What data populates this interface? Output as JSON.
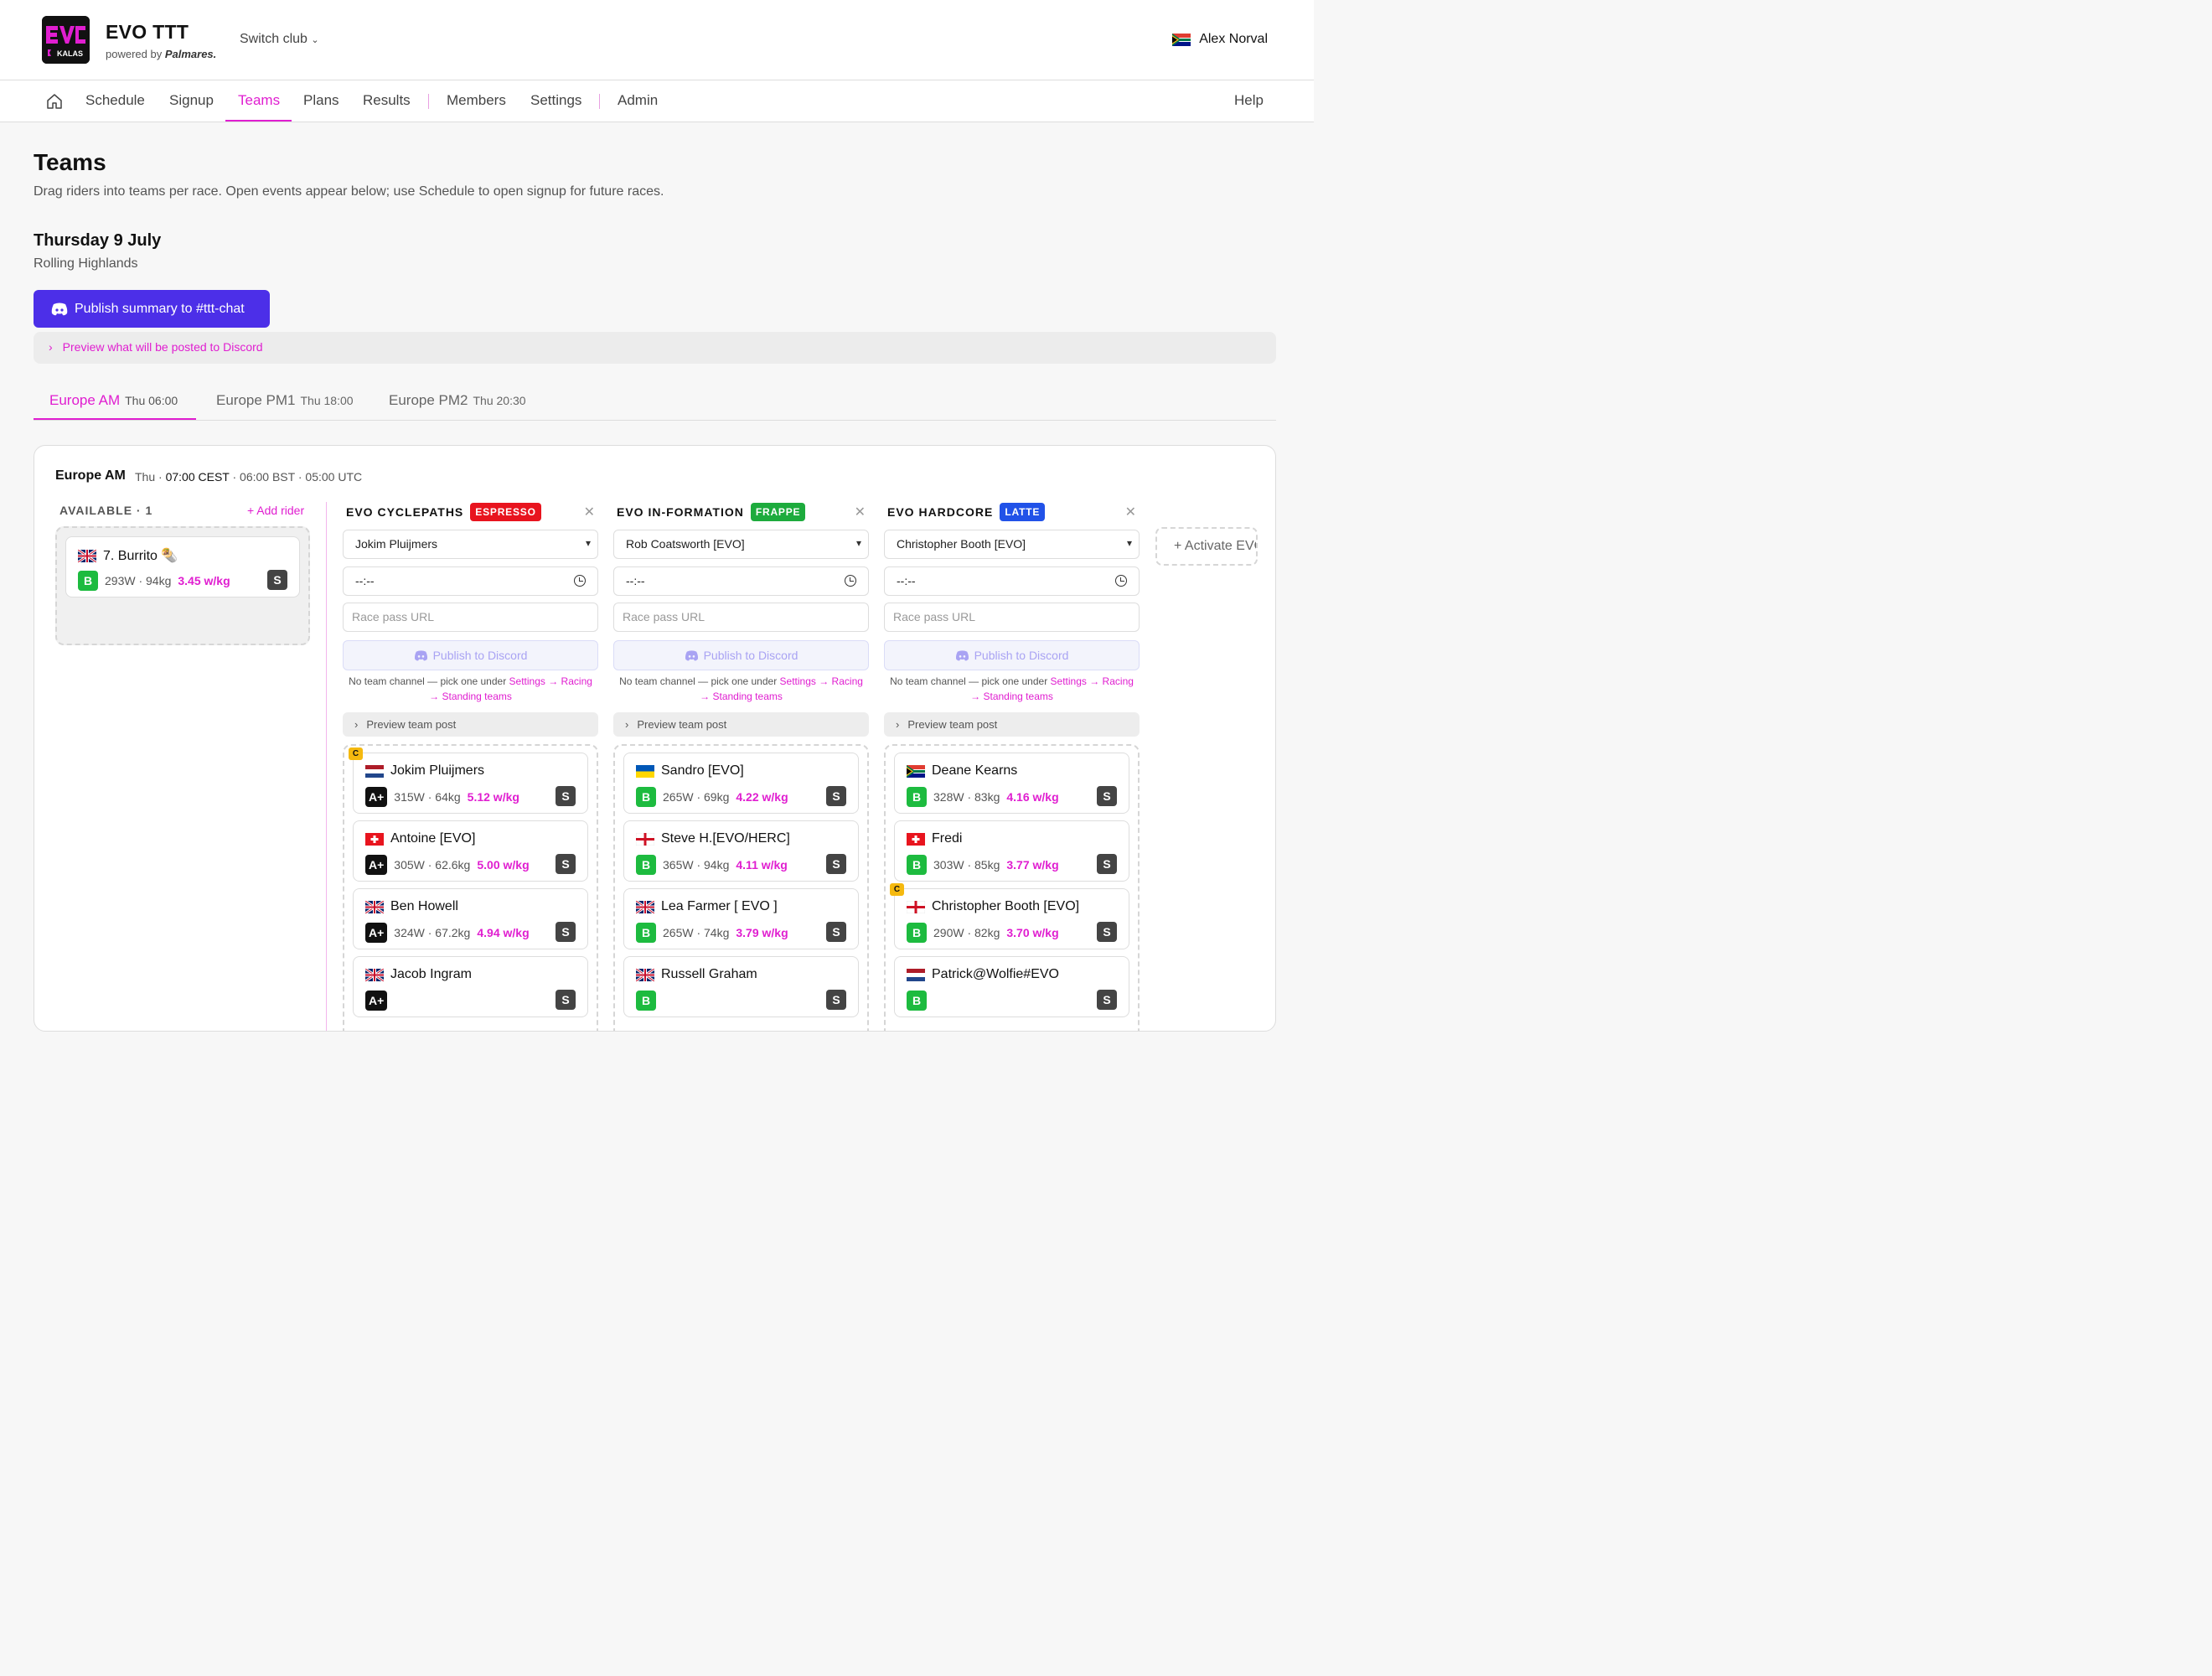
{
  "header": {
    "app_title": "EVO TTT",
    "powered_by_prefix": "powered by",
    "powered_by_brand": "Palmares.",
    "switch_club": "Switch club",
    "user_name": "Alex Norval",
    "logo_text": "KALAS"
  },
  "nav": {
    "items": [
      "Schedule",
      "Signup",
      "Teams",
      "Plans",
      "Results",
      "Members",
      "Settings",
      "Admin"
    ],
    "active": "Teams",
    "help": "Help"
  },
  "page": {
    "title": "Teams",
    "subtitle": "Drag riders into teams per race. Open events appear below; use Schedule to open signup for future races.",
    "date": "Thursday 9 July",
    "course": "Rolling Highlands",
    "publish_button": "Publish summary to #ttt-chat",
    "preview_toggle": "Preview what will be posted to Discord"
  },
  "tabs": [
    {
      "label": "Europe AM",
      "time": "Thu 06:00",
      "active": true
    },
    {
      "label": "Europe PM1",
      "time": "Thu 18:00",
      "active": false
    },
    {
      "label": "Europe PM2",
      "time": "Thu 20:30",
      "active": false
    }
  ],
  "event": {
    "title": "Europe AM",
    "day": "Thu",
    "time_cest": "07:00 CEST",
    "time_bst": "06:00 BST",
    "time_utc": "05:00 UTC"
  },
  "available": {
    "heading": "AVAILABLE · 1",
    "add_rider": "+ Add rider",
    "riders": [
      {
        "flag": "uk",
        "name": "7. Burrito 🌯",
        "cat": "B",
        "stats": "293W · 94kg",
        "wkg": "3.45 w/kg",
        "badge": "S"
      }
    ]
  },
  "team_common": {
    "time_placeholder": "--:--",
    "race_pass_placeholder": "Race pass URL",
    "publish_label": "Publish to Discord",
    "no_channel_prefix": "No team channel — pick one under",
    "no_channel_link": "Settings → Racing → Standing teams",
    "preview_post": "Preview team post"
  },
  "teams": [
    {
      "name": "EVO CYCLEPATHS",
      "badge": "ESPRESSO",
      "badge_color": "#e8141e",
      "captain_select": "Jokim Pluijmers",
      "riders": [
        {
          "flag": "nl",
          "name": "Jokim Pluijmers",
          "cat": "A+",
          "stats": "315W · 64kg",
          "wkg": "5.12 w/kg",
          "badge": "S",
          "captain": "C"
        },
        {
          "flag": "ch",
          "name": "Antoine [EVO]",
          "cat": "A+",
          "stats": "305W · 62.6kg",
          "wkg": "5.00 w/kg",
          "badge": "S"
        },
        {
          "flag": "uk",
          "name": "Ben Howell",
          "cat": "A+",
          "stats": "324W · 67.2kg",
          "wkg": "4.94 w/kg",
          "badge": "S"
        },
        {
          "flag": "uk",
          "name": "Jacob Ingram",
          "cat": "A+",
          "stats": "",
          "wkg": "",
          "badge": "S"
        }
      ]
    },
    {
      "name": "EVO IN-FORMATION",
      "badge": "FRAPPE",
      "badge_color": "#1dab3d",
      "captain_select": "Rob Coatsworth [EVO]",
      "riders": [
        {
          "flag": "ua",
          "name": "Sandro [EVO]",
          "cat": "B",
          "stats": "265W · 69kg",
          "wkg": "4.22 w/kg",
          "badge": "S"
        },
        {
          "flag": "en",
          "name": "Steve H.[EVO/HERC]",
          "cat": "B",
          "stats": "365W · 94kg",
          "wkg": "4.11 w/kg",
          "badge": "S"
        },
        {
          "flag": "uk",
          "name": "Lea Farmer [ EVO ]",
          "cat": "B",
          "stats": "265W · 74kg",
          "wkg": "3.79 w/kg",
          "badge": "S"
        },
        {
          "flag": "uk",
          "name": "Russell Graham",
          "cat": "B",
          "stats": "",
          "wkg": "",
          "badge": "S"
        }
      ]
    },
    {
      "name": "EVO HARDCORE",
      "badge": "LATTE",
      "badge_color": "#2152e8",
      "captain_select": "Christopher Booth [EVO]",
      "riders": [
        {
          "flag": "za",
          "name": "Deane Kearns",
          "cat": "B",
          "stats": "328W · 83kg",
          "wkg": "4.16 w/kg",
          "badge": "S"
        },
        {
          "flag": "ch",
          "name": "Fredi",
          "cat": "B",
          "stats": "303W · 85kg",
          "wkg": "3.77 w/kg",
          "badge": "S"
        },
        {
          "flag": "en",
          "name": "Christopher Booth [EVO]",
          "cat": "B",
          "stats": "290W · 82kg",
          "wkg": "3.70 w/kg",
          "badge": "S",
          "captain": "C"
        },
        {
          "flag": "nl",
          "name": "Patrick@Wolfie#EVO",
          "cat": "B",
          "stats": "",
          "wkg": "",
          "badge": "S"
        }
      ]
    }
  ],
  "activate_label": "+ Activate EVO",
  "colors": {
    "accent": "#e01ed0",
    "discord": "#4c2fe8"
  }
}
